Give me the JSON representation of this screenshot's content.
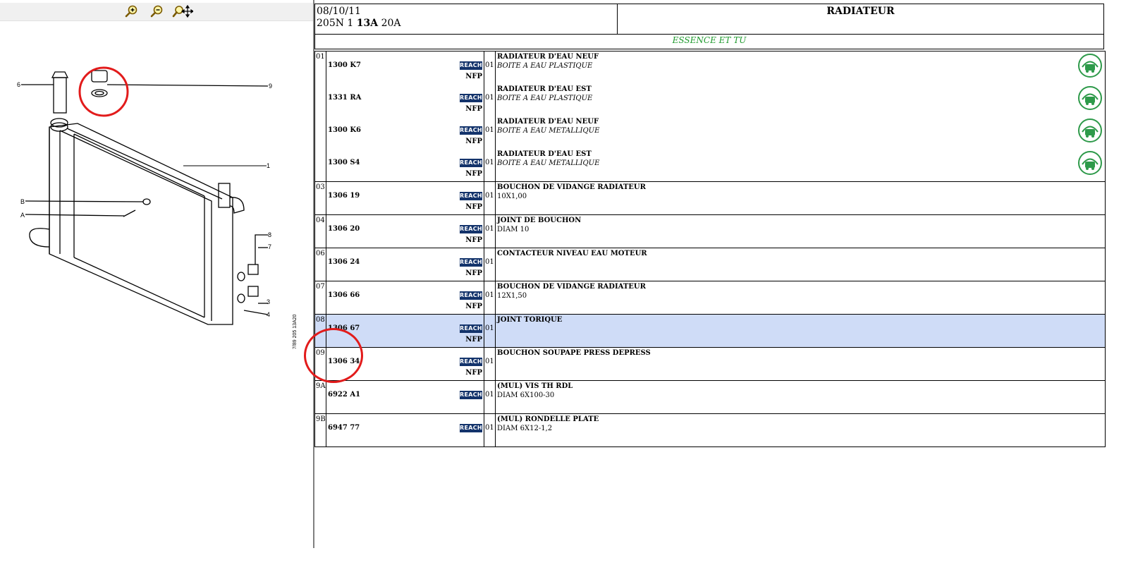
{
  "toolbar": {
    "zoom_in_icon": "zoom-in-icon",
    "zoom_out_icon": "zoom-out-icon",
    "pan_icon": "pan-icon"
  },
  "diagram": {
    "callouts": [
      "6",
      "9",
      "1",
      "B",
      "A",
      "8",
      "7",
      "3",
      "4"
    ],
    "side_text": "7/89 205 13A20"
  },
  "header": {
    "date": "08/10/11",
    "model_prefix": "205N 1 ",
    "model_bold": "13A",
    "model_suffix": " 20A",
    "title": "RADIATEUR"
  },
  "subheader": "ESSENCE ET TU",
  "badges": {
    "reach": "REACH",
    "nfp": "NFP",
    "reuse": "REUSE"
  },
  "colors": {
    "reach_bg": "#13336b",
    "subheader_text": "#1f9a2e",
    "selected_row": "#cfdcf7",
    "circle": "#e21b1b",
    "reuse_icon": "#2e9a4a"
  },
  "groups": [
    {
      "rep": "01",
      "items": [
        {
          "ref": "1300 K7",
          "qty": "01",
          "nfp": true,
          "title": "RADIATEUR D'EAU NEUF",
          "desc": "BOITE A EAU PLASTIQUE",
          "italic": true,
          "reuse": true
        },
        {
          "ref": "1331 RA",
          "qty": "01",
          "nfp": true,
          "title": "RADIATEUR D'EAU EST",
          "desc": "BOITE A EAU PLASTIQUE",
          "italic": true,
          "reuse": true
        },
        {
          "ref": "1300 K6",
          "qty": "01",
          "nfp": true,
          "title": "RADIATEUR D'EAU NEUF",
          "desc": "BOITE A EAU METALLIQUE",
          "italic": true,
          "reuse": true
        },
        {
          "ref": "1300 S4",
          "qty": "01",
          "nfp": true,
          "title": "RADIATEUR D'EAU EST",
          "desc": "BOITE A EAU METALLIQUE",
          "italic": true,
          "reuse": true
        }
      ]
    },
    {
      "rep": "03",
      "items": [
        {
          "ref": "1306 19",
          "qty": "01",
          "nfp": true,
          "title": "BOUCHON DE VIDANGE RADIATEUR",
          "desc": "10X1,00"
        }
      ]
    },
    {
      "rep": "04",
      "items": [
        {
          "ref": "1306 20",
          "qty": "01",
          "nfp": true,
          "title": "JOINT DE BOUCHON",
          "desc": "DIAM 10"
        }
      ]
    },
    {
      "rep": "06",
      "items": [
        {
          "ref": "1306 24",
          "qty": "01",
          "nfp": true,
          "title": "CONTACTEUR NIVEAU EAU MOTEUR",
          "desc": ""
        }
      ]
    },
    {
      "rep": "07",
      "items": [
        {
          "ref": "1306 66",
          "qty": "01",
          "nfp": true,
          "title": "BOUCHON DE VIDANGE RADIATEUR",
          "desc": "12X1,50"
        }
      ]
    },
    {
      "rep": "08",
      "selected": true,
      "items": [
        {
          "ref": "1306 67",
          "qty": "01",
          "nfp": true,
          "title": "JOINT TORIQUE",
          "desc": ""
        }
      ]
    },
    {
      "rep": "09",
      "items": [
        {
          "ref": "1306 34",
          "qty": "01",
          "nfp": true,
          "title": "BOUCHON SOUPAPE PRESS DEPRESS",
          "desc": ""
        }
      ]
    },
    {
      "rep": "9A",
      "items": [
        {
          "ref": "6922 A1",
          "qty": "01",
          "nfp": false,
          "title": "(MUL) VIS TH RDL",
          "desc": "DIAM 6X100-30"
        }
      ]
    },
    {
      "rep": "9B",
      "items": [
        {
          "ref": "6947 77",
          "qty": "01",
          "nfp": false,
          "title": "(MUL) RONDELLE PLATE",
          "desc": "DIAM 6X12-1,2"
        }
      ]
    }
  ]
}
